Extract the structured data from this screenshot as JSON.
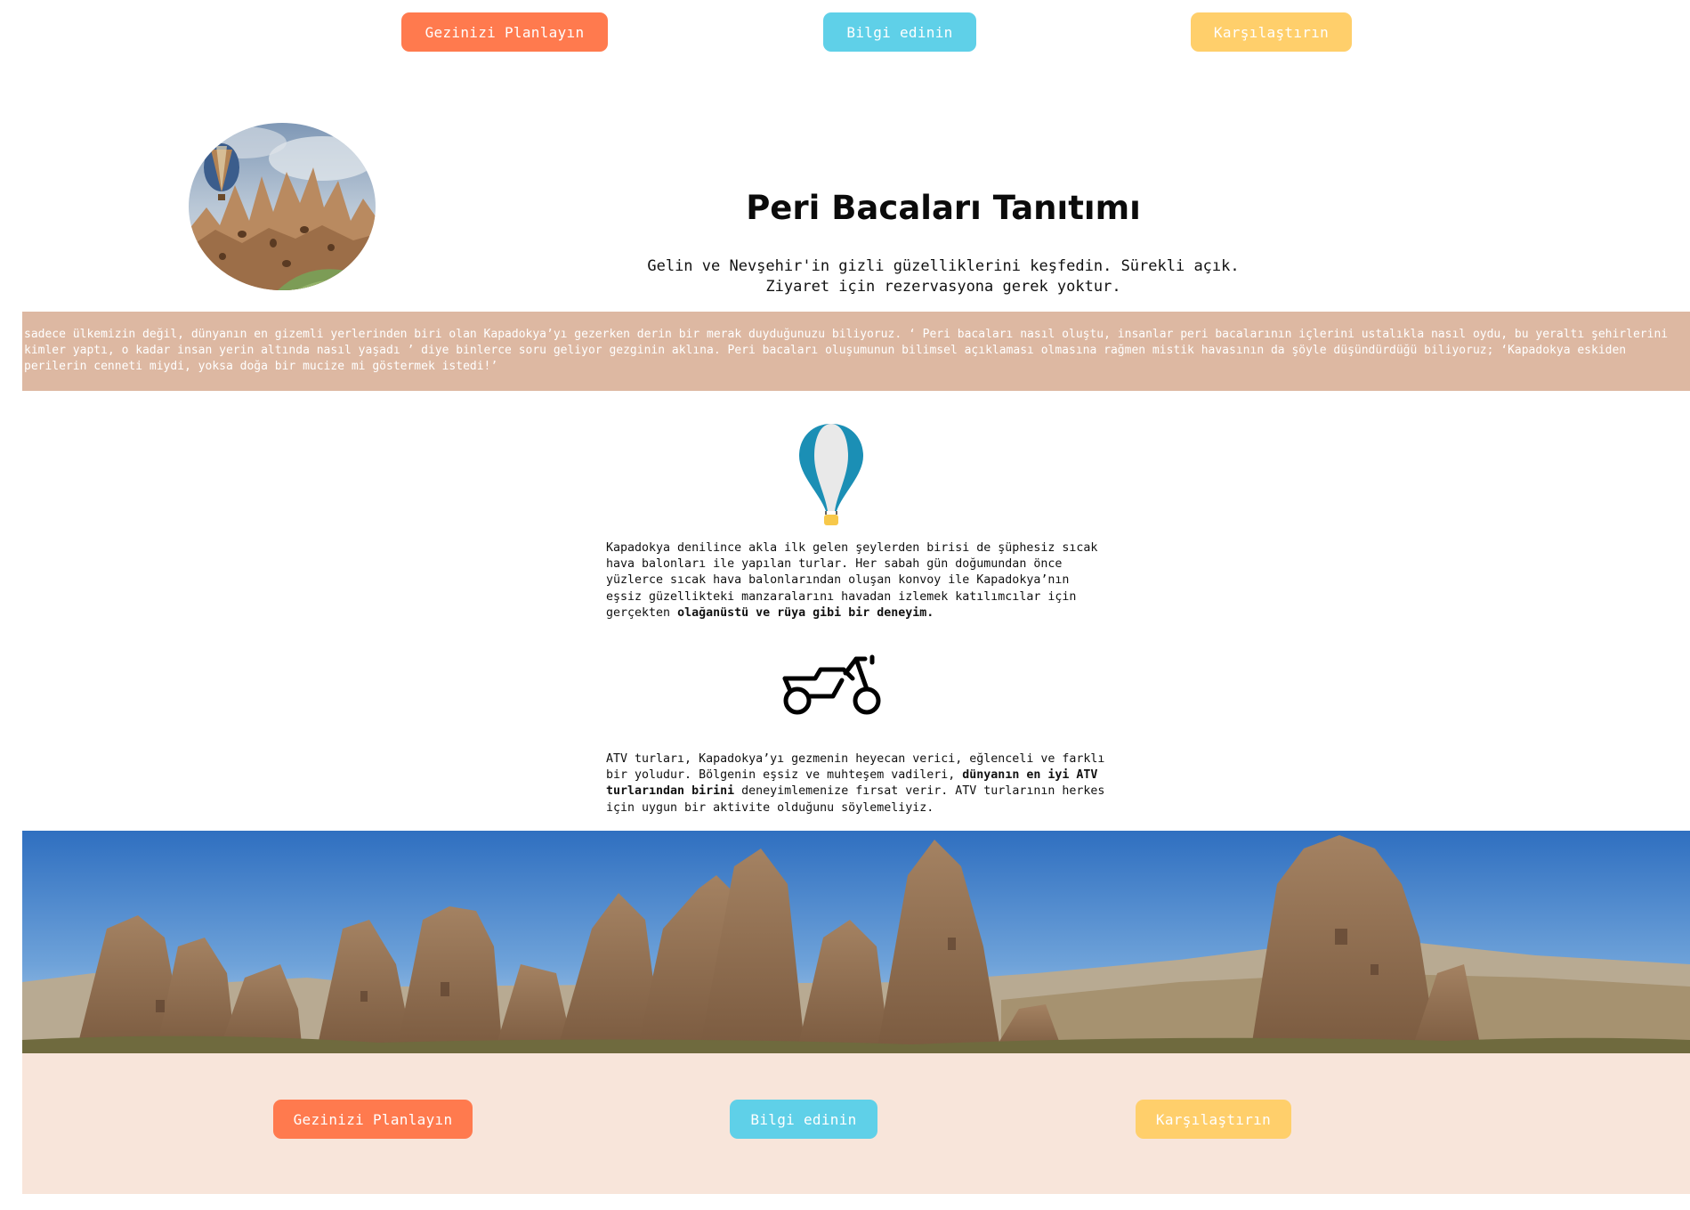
{
  "nav_top": {
    "plan": "Gezinizi Planlayın",
    "info": "Bilgi edinin",
    "compare": "Karşılaştırın"
  },
  "header": {
    "title": "Peri Bacaları Tanıtımı",
    "subtitle_line1": "Gelin ve Nevşehir'in gizli güzelliklerini keşfedin. Sürekli açık.",
    "subtitle_line2": "Ziyaret için rezervasyona gerek yoktur."
  },
  "intro": {
    "text": "sadece ülkemizin değil, dünyanın en gizemli yerlerinden biri olan Kapadokya’yı gezerken derin bir merak duyduğunuzu biliyoruz. ‘ Peri bacaları nasıl oluştu, insanlar peri bacalarının içlerini ustalıkla nasıl oydu, bu yeraltı şehirlerini kimler yaptı, o kadar insan yerin altında nasıl yaşadı ’ diye binlerce soru geliyor gezginin aklına. Peri bacaları oluşumunun bilimsel açıklaması olmasına rağmen mistik havasının da şöyle düşündürdüğü biliyoruz; ‘Kapadokya eskiden perilerin cenneti miydi, yoksa doğa bir mucize mi göstermek istedi!’"
  },
  "balloon_section": {
    "icon": "hot-air-balloon-icon",
    "text_normal": "Kapadokya denilince akla ilk gelen şeylerden birisi de şüphesiz sıcak hava balonları ile yapılan turlar. Her sabah gün doğumundan önce yüzlerce sıcak hava balonlarından oluşan konvoy ile Kapadokya’nın eşsiz güzellikteki manzaralarını havadan izlemek katılımcılar için gerçekten ",
    "text_bold": "olağanüstü ve rüya gibi bir deneyim."
  },
  "atv_section": {
    "icon": "atv-motorcycle-icon",
    "text_part1": "ATV turları, Kapadokya’yı gezmenin heyecan verici, eğlenceli ve farklı bir yoludur. Bölgenin eşsiz ve muhteşem vadileri, ",
    "text_bold": "dünyanın en iyi ATV turlarından birini",
    "text_part2": " deneyimlemenize fırsat verir. ATV turlarının herkes için uygun bir aktivite olduğunu söylemeliyiz."
  },
  "nav_bottom": {
    "plan": "Gezinizi Planlayın",
    "info": "Bilgi edinin",
    "compare": "Karşılaştırın"
  },
  "colors": {
    "orange": "#ff7a4e",
    "cyan": "#5fd0e8",
    "yellow": "#ffcf6b",
    "intro_band": "#ddb8a2",
    "footer_band": "#f8e5da"
  }
}
